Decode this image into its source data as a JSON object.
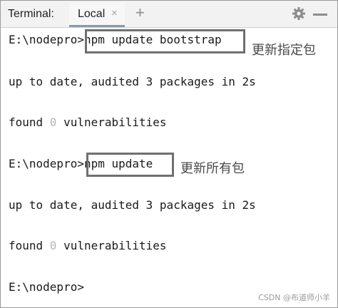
{
  "toolwindow": {
    "title": "Terminal:",
    "tab_label": "Local",
    "tab_close_glyph": "×",
    "new_tab_glyph": "+",
    "settings_icon": "gear-icon",
    "minimize_icon": "minimize-icon"
  },
  "terminal": {
    "lines": {
      "l1_prompt": "E:\\nodepro>",
      "l1_cmd": "npm update bootstrap",
      "l2": "up to date, audited 3 packages in 2s",
      "l3_a": "found ",
      "l3_zero": "0",
      "l3_b": " vulnerabilities",
      "l4_prompt": "E:\\nodepro>",
      "l4_cmd": "npm update",
      "l5": "up to date, audited 3 packages in 2s",
      "l6_a": "found ",
      "l6_zero": "0",
      "l6_b": " vulnerabilities",
      "l7_prompt": "E:\\nodepro>"
    }
  },
  "annotations": {
    "first": "更新指定包",
    "second": "更新所有包"
  },
  "watermark": "CSDN @布道师小羊"
}
